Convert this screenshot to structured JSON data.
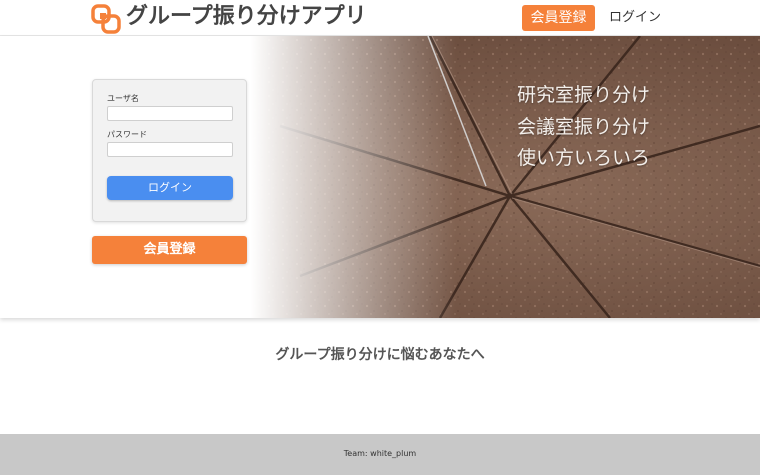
{
  "header": {
    "app_title": "グループ振り分けアプリ",
    "logo_icon": "linked-squares-logo-icon",
    "register_label": "会員登録",
    "login_label": "ログイン"
  },
  "hero": {
    "taglines": [
      "研究室振り分け",
      "会議室振り分け",
      "使い方いろいろ"
    ]
  },
  "login_form": {
    "username_label": "ユーザ名",
    "username_value": "",
    "password_label": "パスワード",
    "password_value": "",
    "login_button": "ログイン"
  },
  "register_button": "会員登録",
  "section": {
    "heading": "グループ振り分けに悩むあなたへ"
  },
  "footer": {
    "text": "Team: white_plum"
  },
  "colors": {
    "accent_orange": "#f5813a",
    "primary_blue": "#4a8ef0",
    "footer_gray": "#c8c8c8",
    "cake_brown": "#7a5a4a"
  }
}
